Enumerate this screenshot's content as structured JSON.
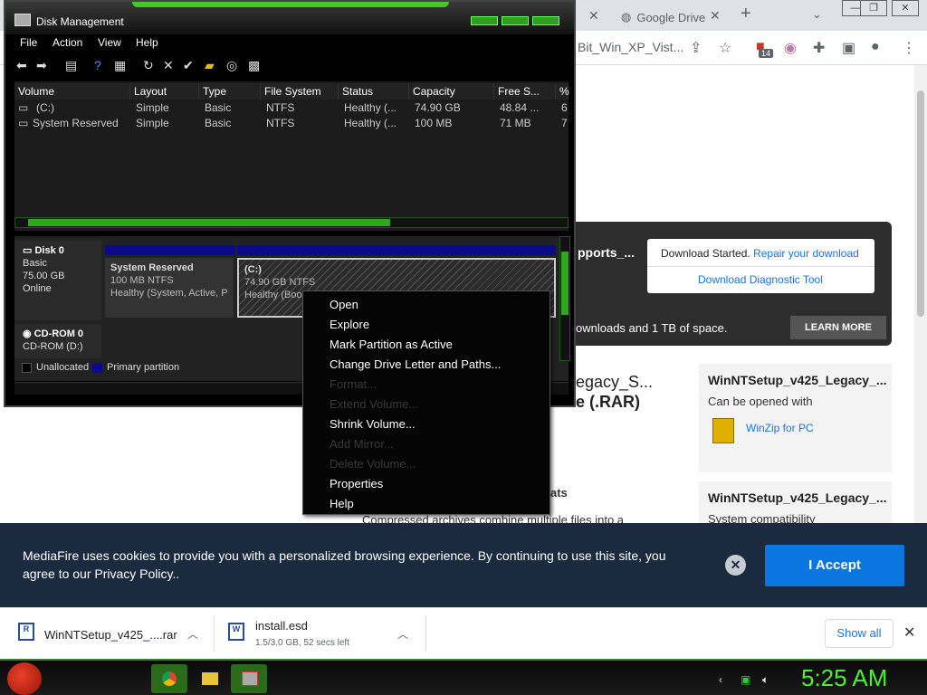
{
  "browser": {
    "tabs": [
      {
        "label": ""
      },
      {
        "label": "Google Drive"
      }
    ],
    "omnibox_text": "Bit_Win_XP_Vist...",
    "extension_badge": "14"
  },
  "banner": {
    "title": "pports_...",
    "download_started": "Download Started.",
    "repair_link": "Repair your download",
    "diagnostic_link": "Download Diagnostic Tool",
    "promo_text": "ownloads and 1 TB of space.",
    "learn_more": "LEARN MORE"
  },
  "file_title": {
    "line1": "egacy_S...",
    "line2": "e (.RAR)"
  },
  "cards": [
    {
      "title": "WinNTSetup_v425_Legacy_...",
      "subtitle": "Can be opened with",
      "app": "WinZip for PC"
    },
    {
      "title": "WinNTSetup_v425_Legacy_...",
      "subtitle": "System compatibility"
    }
  ],
  "mid_text": {
    "formats": "ats",
    "compressed": "Compressed archives combine multiple files into a"
  },
  "cookie": {
    "text": "MediaFire uses cookies to provide you with a personalized browsing experience. By continuing to use this site, you agree to our Privacy Policy..",
    "accept": "I Accept"
  },
  "downloads": [
    {
      "name": "WinNTSetup_v425_....rar",
      "status": "",
      "icon_text": "R"
    },
    {
      "name": "install.esd",
      "status": "1.5/3.0 GB, 52 secs left",
      "icon_text": "W"
    }
  ],
  "show_all": "Show all",
  "disk_mgmt": {
    "title": "Disk Management",
    "menus": [
      "File",
      "Action",
      "View",
      "Help"
    ],
    "columns": [
      "Volume",
      "Layout",
      "Type",
      "File System",
      "Status",
      "Capacity",
      "Free S...",
      "%"
    ],
    "rows": [
      [
        "(C:)",
        "Simple",
        "Basic",
        "NTFS",
        "Healthy (...",
        "74.90 GB",
        "48.84 ...",
        "6"
      ],
      [
        "System Reserved",
        "Simple",
        "Basic",
        "NTFS",
        "Healthy (...",
        "100 MB",
        "71 MB",
        "7"
      ]
    ],
    "disks": [
      {
        "name": "Disk 0",
        "type": "Basic",
        "size": "75.00 GB",
        "state": "Online"
      },
      {
        "name": "CD-ROM 0",
        "type": "CD-ROM (D:)"
      }
    ],
    "partitions": [
      {
        "name": "System Reserved",
        "size": "100 MB NTFS",
        "status": "Healthy (System, Active, P"
      },
      {
        "name": "(C:)",
        "size": "74.90 GB NTFS",
        "status": "Healthy (Boot,"
      }
    ],
    "legend": {
      "unallocated": "Unallocated",
      "primary": "Primary partition"
    },
    "colors": {
      "primary": "#0a0a8a",
      "accent": "#2fa61e"
    }
  },
  "context_menu": [
    {
      "label": "Open",
      "enabled": true
    },
    {
      "label": "Explore",
      "enabled": true
    },
    {
      "label": "Mark Partition as Active",
      "enabled": true
    },
    {
      "label": "Change Drive Letter and Paths...",
      "enabled": true
    },
    {
      "label": "Format...",
      "enabled": false
    },
    {
      "label": "Extend Volume...",
      "enabled": false
    },
    {
      "label": "Shrink Volume...",
      "enabled": true
    },
    {
      "label": "Add Mirror...",
      "enabled": false
    },
    {
      "label": "Delete Volume...",
      "enabled": false
    },
    {
      "label": "Properties",
      "enabled": true
    },
    {
      "label": "Help",
      "enabled": true
    }
  ],
  "taskbar": {
    "clock": "5:25 AM"
  }
}
